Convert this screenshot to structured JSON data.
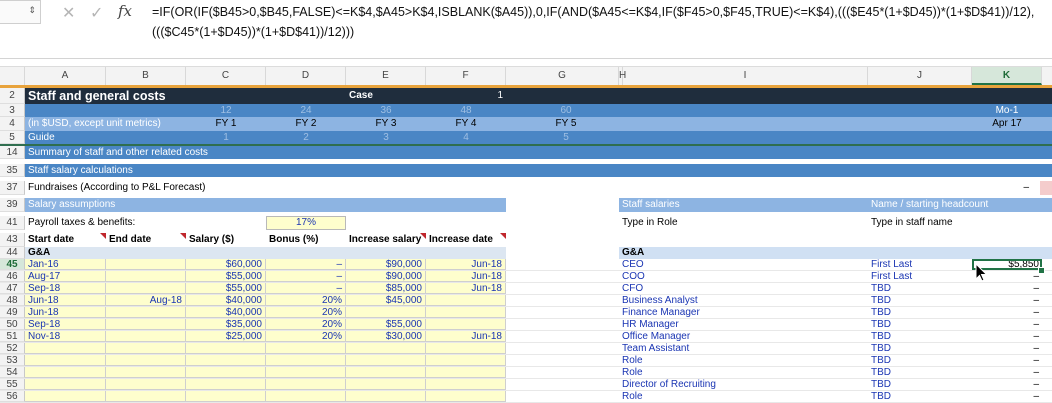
{
  "formula_bar": {
    "namebox_stub": "",
    "cancel_icon": "✕",
    "enter_icon": "✓",
    "fx_label": "fx",
    "formula": "=IF(OR(IF($B45>0,$B45,FALSE)<=K$4,$A45>K$4,ISBLANK($A45)),0,IF(AND($A45<=K$4,IF($F45>0,$F45,TRUE)<=K$4),((($E45*(1+$D45))*(1+$D$41))/12),((($C45*(1+$D45))*(1+$D$41))/12)))"
  },
  "columns": [
    "A",
    "B",
    "C",
    "D",
    "E",
    "F",
    "G",
    "H",
    "I",
    "J",
    "K"
  ],
  "selected_column": "K",
  "colors": {
    "title_bar": "#1f2d3d",
    "accent_orange": "#e8a33c",
    "header_blue": "#4a86c5",
    "light_blue": "#8db4e2",
    "pale_blue": "#dce6f1",
    "section_blue": "#d0e0f3",
    "input_yellow": "#fefecd",
    "input_text": "#1a35b3",
    "excel_green": "#217346"
  },
  "rows": {
    "r2": {
      "num": "2",
      "title": "Staff and general costs",
      "case_label": "Case",
      "case_value": "1"
    },
    "r3": {
      "num": "3",
      "c": "12",
      "d": "24",
      "e": "36",
      "f": "48",
      "g": "60",
      "k": "Mo-1"
    },
    "r4": {
      "num": "4",
      "a": "(in $USD, except unit metrics)",
      "c": "FY 1",
      "d": "FY 2",
      "e": "FY 3",
      "f": "FY 4",
      "g": "FY 5",
      "k": "Apr 17"
    },
    "r5": {
      "num": "5",
      "a": "Guide",
      "c": "1",
      "d": "2",
      "e": "3",
      "f": "4",
      "g": "5"
    },
    "r14": {
      "num": "14",
      "a": "Summary of staff and other related costs"
    },
    "r35": {
      "num": "35",
      "a": "Staff salary calculations"
    },
    "r37": {
      "num": "37",
      "a": "Fundraises (According to P&L Forecast)",
      "k": "–"
    },
    "r39": {
      "num": "39",
      "a": "Salary assumptions",
      "i": "Staff salaries",
      "j": "Name / starting headcount"
    },
    "r41": {
      "num": "41",
      "a": "Payroll taxes & benefits:",
      "d": "17%",
      "i": "Type in Role",
      "j": "Type in staff name"
    },
    "r43": {
      "num": "43",
      "a": "Start date",
      "b": "End date",
      "c": "Salary ($)",
      "d": "Bonus (%)",
      "e": "Increase salary",
      "f": "Increase date"
    },
    "r44": {
      "num": "44",
      "a": "G&A",
      "i": "G&A"
    }
  },
  "data_rows": [
    {
      "num": "45",
      "a": "Jan-16",
      "b": "",
      "c": "$60,000",
      "d": "–",
      "e": "$90,000",
      "f": "Jun-18",
      "role": "CEO",
      "name": "First Last",
      "k": "$5,850"
    },
    {
      "num": "46",
      "a": "Aug-17",
      "b": "",
      "c": "$55,000",
      "d": "–",
      "e": "$90,000",
      "f": "Jun-18",
      "role": "COO",
      "name": "First Last",
      "k": "–"
    },
    {
      "num": "47",
      "a": "Sep-18",
      "b": "",
      "c": "$55,000",
      "d": "–",
      "e": "$85,000",
      "f": "Jun-18",
      "role": "CFO",
      "name": "TBD",
      "k": "–"
    },
    {
      "num": "48",
      "a": "Jun-18",
      "b": "Aug-18",
      "c": "$40,000",
      "d": "20%",
      "e": "$45,000",
      "f": "",
      "role": "Business Analyst",
      "name": "TBD",
      "k": "–"
    },
    {
      "num": "49",
      "a": "Jun-18",
      "b": "",
      "c": "$40,000",
      "d": "20%",
      "e": "",
      "f": "",
      "role": "Finance Manager",
      "name": "TBD",
      "k": "–"
    },
    {
      "num": "50",
      "a": "Sep-18",
      "b": "",
      "c": "$35,000",
      "d": "20%",
      "e": "$55,000",
      "f": "",
      "role": "HR Manager",
      "name": "TBD",
      "k": "–"
    },
    {
      "num": "51",
      "a": "Nov-18",
      "b": "",
      "c": "$25,000",
      "d": "20%",
      "e": "$30,000",
      "f": "Jun-18",
      "role": "Office Manager",
      "name": "TBD",
      "k": "–"
    },
    {
      "num": "52",
      "a": "",
      "b": "",
      "c": "",
      "d": "",
      "e": "",
      "f": "",
      "role": "Team Assistant",
      "name": "TBD",
      "k": "–"
    },
    {
      "num": "53",
      "a": "",
      "b": "",
      "c": "",
      "d": "",
      "e": "",
      "f": "",
      "role": "Role",
      "name": "TBD",
      "k": "–"
    },
    {
      "num": "54",
      "a": "",
      "b": "",
      "c": "",
      "d": "",
      "e": "",
      "f": "",
      "role": "Role",
      "name": "TBD",
      "k": "–"
    },
    {
      "num": "55",
      "a": "",
      "b": "",
      "c": "",
      "d": "",
      "e": "",
      "f": "",
      "role": "Director of Recruiting",
      "name": "TBD",
      "k": "–"
    },
    {
      "num": "56",
      "a": "",
      "b": "",
      "c": "",
      "d": "",
      "e": "",
      "f": "",
      "role": "Role",
      "name": "TBD",
      "k": "–"
    }
  ]
}
